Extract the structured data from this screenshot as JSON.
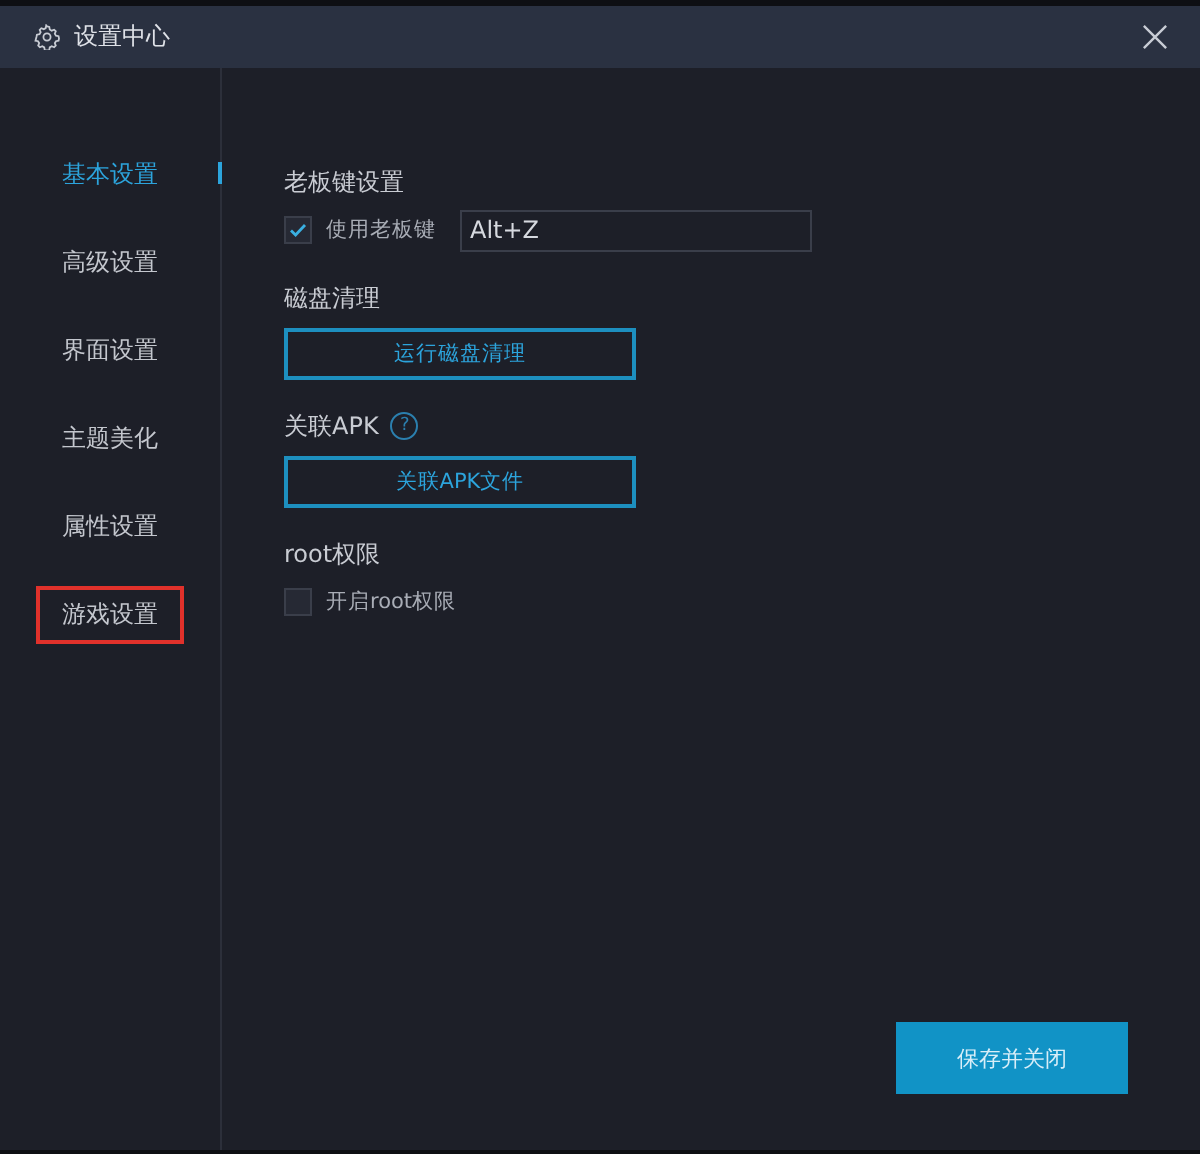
{
  "window": {
    "title": "设置中心"
  },
  "sidebar": {
    "items": [
      {
        "label": "基本设置",
        "selected": true,
        "highlighted": false
      },
      {
        "label": "高级设置",
        "selected": false,
        "highlighted": false
      },
      {
        "label": "界面设置",
        "selected": false,
        "highlighted": false
      },
      {
        "label": "主题美化",
        "selected": false,
        "highlighted": false
      },
      {
        "label": "属性设置",
        "selected": false,
        "highlighted": false
      },
      {
        "label": "游戏设置",
        "selected": false,
        "highlighted": true
      }
    ]
  },
  "sections": [
    {
      "kind": "hotkey",
      "title": "老板键设置",
      "checkbox": {
        "label": "使用老板键",
        "checked": true
      },
      "value": "Alt+Z"
    },
    {
      "kind": "button",
      "title": "磁盘清理",
      "button": "运行磁盘清理"
    },
    {
      "kind": "button",
      "title": "关联APK",
      "help": "?",
      "button": "关联APK文件"
    },
    {
      "kind": "checkbox",
      "title": "root权限",
      "checkbox": {
        "label": "开启root权限",
        "checked": false
      }
    }
  ],
  "save_button": "保存并关闭"
}
